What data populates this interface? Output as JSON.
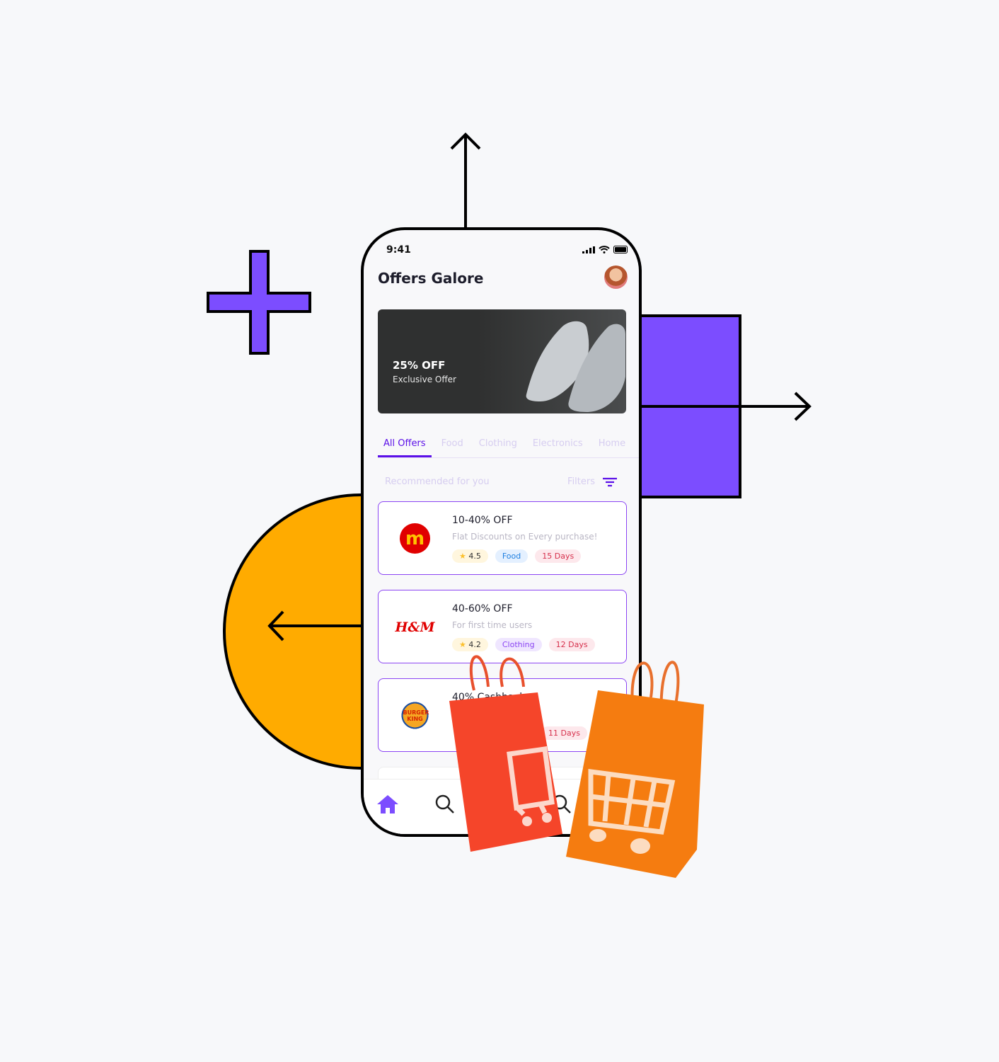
{
  "status": {
    "time": "9:41"
  },
  "header": {
    "title": "Offers Galore"
  },
  "banner": {
    "headline": "25% OFF",
    "subtitle": "Exclusive Offer"
  },
  "tabs": [
    {
      "label": "All Offers",
      "active": true
    },
    {
      "label": "Food"
    },
    {
      "label": "Clothing"
    },
    {
      "label": "Electronics"
    },
    {
      "label": "Home"
    }
  ],
  "section": {
    "title": "Recommended for you",
    "filters_label": "Filters"
  },
  "offers": [
    {
      "brand": "McDonald's",
      "title": "10-40% OFF",
      "subtitle": "Flat Discounts on Every purchase!",
      "rating": "4.5",
      "category": "Food",
      "duration": "15 Days"
    },
    {
      "brand": "H&M",
      "logo_text": "H&M",
      "title": "40-60% OFF",
      "subtitle": "For first time users",
      "rating": "4.2",
      "category": "Clothing",
      "duration": "12 Days"
    },
    {
      "brand": "Burger King",
      "logo_text": "BURGER KING",
      "title": "40% Cashback",
      "duration": "11 Days"
    }
  ],
  "nav": [
    "home-icon",
    "search-icon",
    "search-icon"
  ],
  "colors": {
    "accent": "#5b10e8",
    "purple": "#7c4dff",
    "orange": "#ffab00",
    "bag_red": "#f5452a",
    "bag_orange": "#f57c10"
  }
}
